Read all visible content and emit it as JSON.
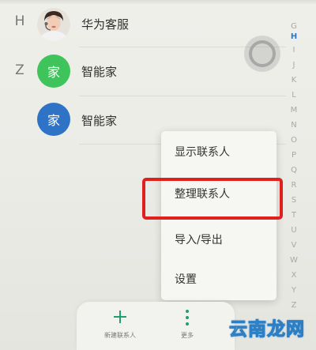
{
  "contacts": [
    {
      "section": "H",
      "name": "华为客服",
      "avatar": "person-photo"
    },
    {
      "section": "Z",
      "name": "智能家",
      "avatar_text": "家",
      "avatar_color": "#3ec45a"
    },
    {
      "section": "",
      "name": "智能家",
      "avatar_text": "家",
      "avatar_color": "#2e73c6"
    }
  ],
  "alpha_index": [
    "G",
    "H",
    "I",
    "J",
    "K",
    "L",
    "M",
    "N",
    "O",
    "P",
    "Q",
    "R",
    "S",
    "T",
    "U",
    "V",
    "W",
    "X",
    "Y",
    "Z"
  ],
  "alpha_active": "H",
  "menu": {
    "items": [
      "显示联系人",
      "整理联系人",
      "导入/导出",
      "设置"
    ],
    "highlighted": "整理联系人",
    "highlight_color": "#e01f1f"
  },
  "bottom_bar": {
    "new_contact_label": "新建联系人",
    "more_label": "更多",
    "accent_color": "#1f9e72"
  },
  "watermark": "云南龙网"
}
